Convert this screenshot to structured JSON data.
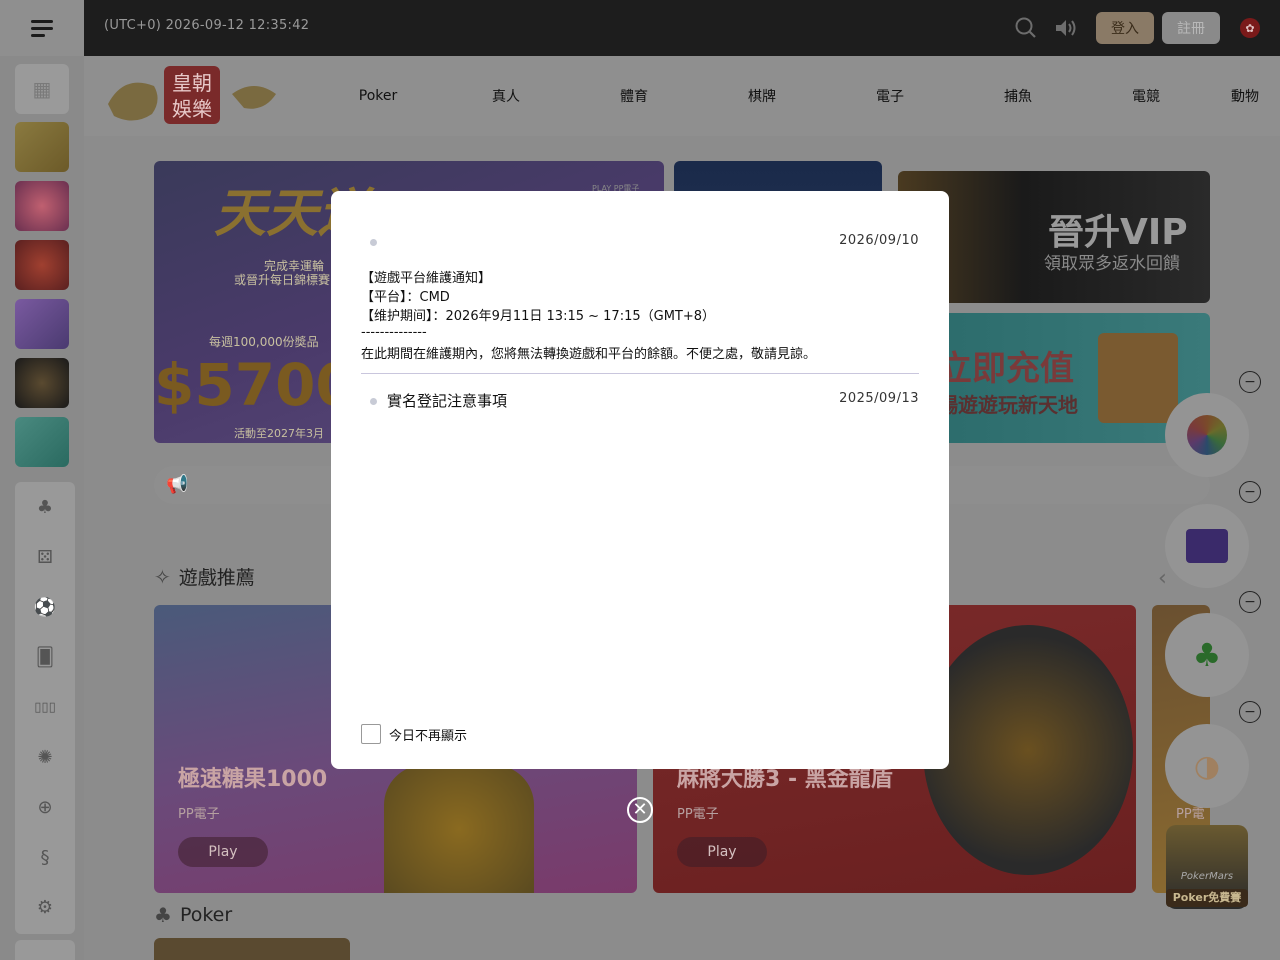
{
  "topbar": {
    "datetime": "(UTC+0) 2026-09-12 12:35:42",
    "login_label": "登入",
    "register_label": "註冊"
  },
  "nav": {
    "items": [
      "Poker",
      "真人",
      "體育",
      "棋牌",
      "電子",
      "捕魚",
      "電競",
      "動物"
    ]
  },
  "logo": {
    "line1": "皇朝",
    "line2": "娛樂"
  },
  "banners": {
    "left_title": "天天送",
    "left_line1": "完成幸運輪",
    "left_line2": "或晉升每日錦標賽",
    "left_weekly": "每週100,000份獎品",
    "left_amount": "$5700",
    "left_footer": "活動至2027年3月",
    "left_brand": "PLAY PP電子",
    "vip_title": "晉升VIP",
    "vip_sub": "領取眾多返水回饋",
    "deposit_title": "立即充值",
    "deposit_sub": "暢遊遊玩新天地"
  },
  "sections": {
    "recommend_title": "遊戲推薦",
    "poker_title": "Poker"
  },
  "games": [
    {
      "title": "極速糖果1000",
      "provider": "PP電子",
      "play": "Play"
    },
    {
      "title": "麻將大勝3 - 黑金龍盾",
      "provider": "PP電子",
      "play": "Play"
    },
    {
      "title": "",
      "provider": "PP電",
      "play": ""
    }
  ],
  "float": {
    "pokermars_line1": "PokerMars",
    "pokermars_line2": "Poker免費賽"
  },
  "modal": {
    "notice1": {
      "date": "2026/09/10",
      "lines": [
        "【遊戲平台維護通知】",
        "【平台】：CMD",
        "【维护期间】：2026年9月11日 13:15 ~ 17:15（GMT+8）",
        "--------------",
        "在此期間在維護期內，您將無法轉換遊戲和平台的餘額。不便之處，敬請見諒。"
      ]
    },
    "notice2": {
      "title": "實名登記注意事項",
      "date": "2025/09/13"
    },
    "dont_show_label": "今日不再顯示"
  },
  "colors": {
    "overlay": "#8c8c8c",
    "modal_bg": "#ffffff",
    "accent_gold": "#8a7a66"
  },
  "icons": {
    "search": "search-icon",
    "sound": "speaker-icon",
    "close": "close-icon"
  }
}
